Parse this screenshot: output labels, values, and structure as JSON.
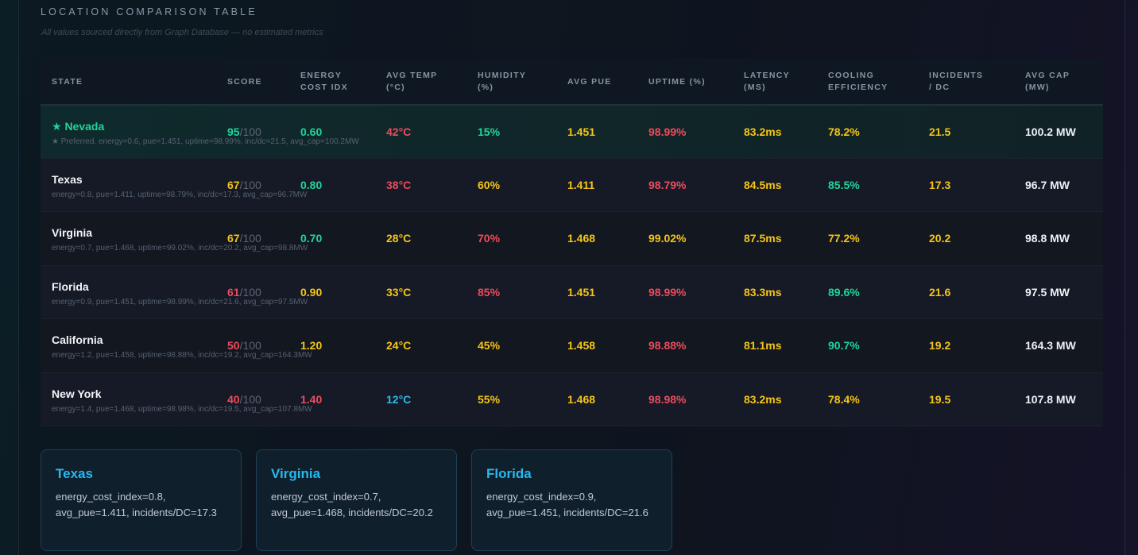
{
  "section": {
    "title": "LOCATION COMPARISON TABLE",
    "subtitle": "All values sourced directly from Graph Database — no estimated metrics"
  },
  "columns": [
    "STATE",
    "SCORE",
    "ENERGY COST IDX",
    "AVG TEMP (°C)",
    "HUMIDITY (%)",
    "AVG PUE",
    "UPTIME (%)",
    "LATENCY (MS)",
    "COOLING EFFICIENCY",
    "INCIDENTS / DC",
    "AVG CAP (MW)"
  ],
  "colors": {
    "good": "#22d49b",
    "warn": "#f5c518",
    "bad": "#ee4b5c",
    "cool": "#2fb8e6"
  },
  "rows": [
    {
      "state": "★  Nevada",
      "preferred": true,
      "desc": "★ Preferred. energy=0.6, pue=1.451, uptime=98.99%, inc/dc=21.5, avg_cap=100.2MW",
      "score": "95",
      "score_max": "/100",
      "energy": "0.60",
      "temp": "42°C",
      "humidity": "15%",
      "pue": "1.451",
      "uptime": "98.99%",
      "latency": "83.2ms",
      "cooling": "78.2%",
      "incidents": "21.5",
      "cap": "100.2 MW",
      "tone": [
        "green",
        "green",
        "red",
        "green",
        "yellow",
        "red",
        "yellow",
        "yellow",
        "yellow",
        "white"
      ]
    },
    {
      "state": "Texas",
      "preferred": false,
      "desc": "energy=0.8, pue=1.411, uptime=98.79%, inc/dc=17.3, avg_cap=96.7MW",
      "score": "67",
      "score_max": "/100",
      "energy": "0.80",
      "temp": "38°C",
      "humidity": "60%",
      "pue": "1.411",
      "uptime": "98.79%",
      "latency": "84.5ms",
      "cooling": "85.5%",
      "incidents": "17.3",
      "cap": "96.7 MW",
      "tone": [
        "yellow",
        "green",
        "red",
        "yellow",
        "yellow",
        "red",
        "yellow",
        "green",
        "yellow",
        "white"
      ]
    },
    {
      "state": "Virginia",
      "preferred": false,
      "desc": "energy=0.7, pue=1.468, uptime=99.02%, inc/dc=20.2, avg_cap=98.8MW",
      "score": "67",
      "score_max": "/100",
      "energy": "0.70",
      "temp": "28°C",
      "humidity": "70%",
      "pue": "1.468",
      "uptime": "99.02%",
      "latency": "87.5ms",
      "cooling": "77.2%",
      "incidents": "20.2",
      "cap": "98.8 MW",
      "tone": [
        "yellow",
        "green",
        "yellow",
        "red",
        "yellow",
        "yellow",
        "yellow",
        "yellow",
        "yellow",
        "white"
      ]
    },
    {
      "state": "Florida",
      "preferred": false,
      "desc": "energy=0.9, pue=1.451, uptime=98.99%, inc/dc=21.6, avg_cap=97.5MW",
      "score": "61",
      "score_max": "/100",
      "energy": "0.90",
      "temp": "33°C",
      "humidity": "85%",
      "pue": "1.451",
      "uptime": "98.99%",
      "latency": "83.3ms",
      "cooling": "89.6%",
      "incidents": "21.6",
      "cap": "97.5 MW",
      "tone": [
        "red",
        "yellow",
        "yellow",
        "red",
        "yellow",
        "red",
        "yellow",
        "green",
        "yellow",
        "white"
      ]
    },
    {
      "state": "California",
      "preferred": false,
      "desc": "energy=1.2, pue=1.458, uptime=98.88%, inc/dc=19.2, avg_cap=164.3MW",
      "score": "50",
      "score_max": "/100",
      "energy": "1.20",
      "temp": "24°C",
      "humidity": "45%",
      "pue": "1.458",
      "uptime": "98.88%",
      "latency": "81.1ms",
      "cooling": "90.7%",
      "incidents": "19.2",
      "cap": "164.3 MW",
      "tone": [
        "red",
        "yellow",
        "yellow",
        "yellow",
        "yellow",
        "red",
        "yellow",
        "green",
        "yellow",
        "white"
      ]
    },
    {
      "state": "New York",
      "preferred": false,
      "desc": "energy=1.4, pue=1.468, uptime=98.98%, inc/dc=19.5, avg_cap=107.8MW",
      "score": "40",
      "score_max": "/100",
      "energy": "1.40",
      "temp": "12°C",
      "humidity": "55%",
      "pue": "1.468",
      "uptime": "98.98%",
      "latency": "83.2ms",
      "cooling": "78.4%",
      "incidents": "19.5",
      "cap": "107.8 MW",
      "tone": [
        "red",
        "red",
        "blue",
        "yellow",
        "yellow",
        "red",
        "yellow",
        "yellow",
        "yellow",
        "white"
      ]
    }
  ],
  "cards": [
    {
      "title": "Texas",
      "body": "energy_cost_index=0.8, avg_pue=1.411, incidents/DC=17.3"
    },
    {
      "title": "Virginia",
      "body": "energy_cost_index=0.7, avg_pue=1.468, incidents/DC=20.2"
    },
    {
      "title": "Florida",
      "body": "energy_cost_index=0.9, avg_pue=1.451, incidents/DC=21.6"
    }
  ]
}
